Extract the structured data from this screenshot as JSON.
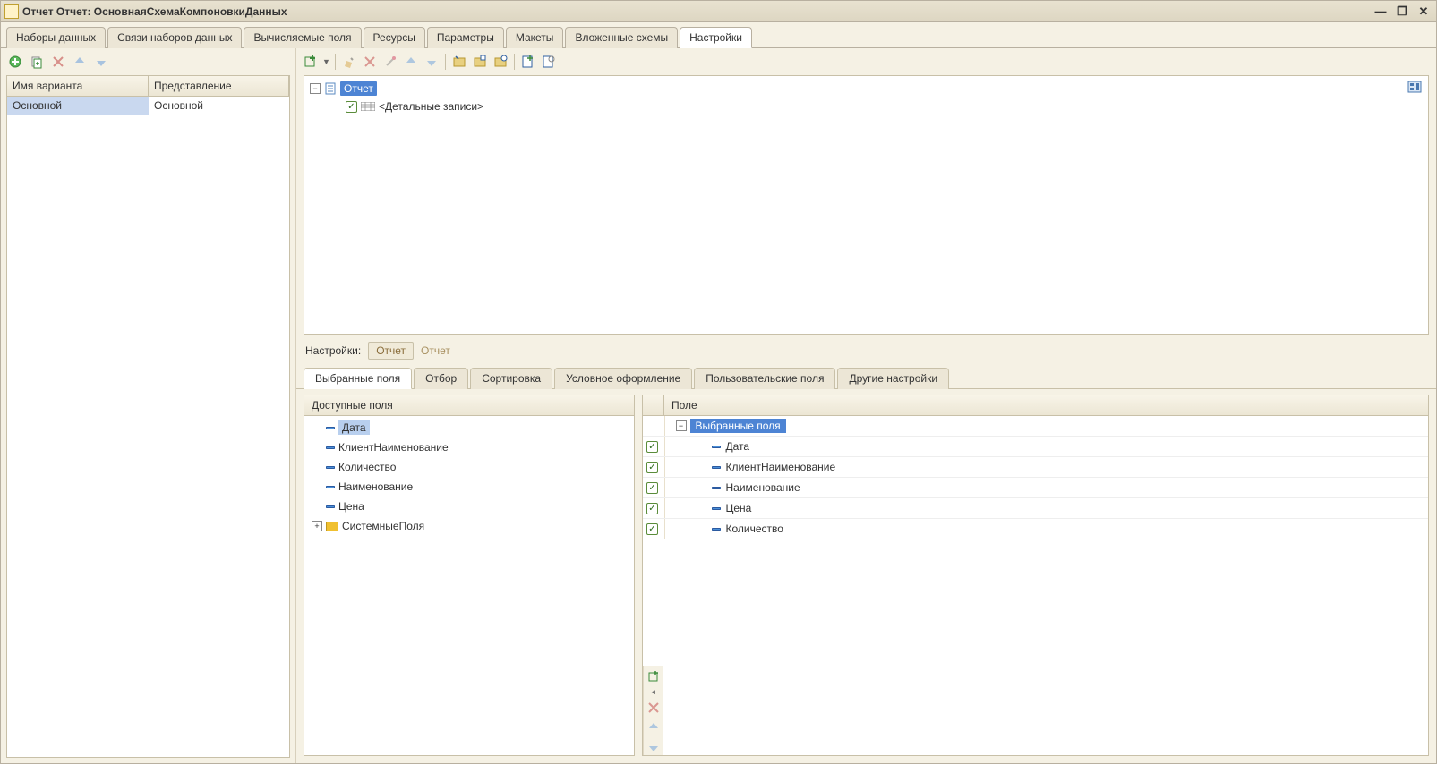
{
  "window": {
    "title": "Отчет Отчет: ОсновнаяСхемаКомпоновкиДанных"
  },
  "mainTabs": [
    {
      "label": "Наборы данных",
      "active": false
    },
    {
      "label": "Связи наборов данных",
      "active": false
    },
    {
      "label": "Вычисляемые поля",
      "active": false
    },
    {
      "label": "Ресурсы",
      "active": false
    },
    {
      "label": "Параметры",
      "active": false
    },
    {
      "label": "Макеты",
      "active": false
    },
    {
      "label": "Вложенные схемы",
      "active": false
    },
    {
      "label": "Настройки",
      "active": true
    }
  ],
  "variants": {
    "header": {
      "col1": "Имя варианта",
      "col2": "Представление"
    },
    "rows": [
      {
        "name": "Основной",
        "presentation": "Основной",
        "selected": true
      }
    ]
  },
  "reportTree": {
    "root": {
      "label": "Отчет",
      "selected": true
    },
    "child": {
      "label": "<Детальные записи>",
      "checked": true
    }
  },
  "breadcrumb": {
    "label": "Настройки:",
    "btn": "Отчет",
    "text": "Отчет"
  },
  "subTabs": [
    {
      "label": "Выбранные поля",
      "active": true
    },
    {
      "label": "Отбор",
      "active": false
    },
    {
      "label": "Сортировка",
      "active": false
    },
    {
      "label": "Условное оформление",
      "active": false
    },
    {
      "label": "Пользовательские поля",
      "active": false
    },
    {
      "label": "Другие настройки",
      "active": false
    }
  ],
  "available": {
    "header": "Доступные поля",
    "fields": [
      {
        "label": "Дата",
        "selected": true,
        "type": "field"
      },
      {
        "label": "КлиентНаименование",
        "type": "field"
      },
      {
        "label": "Количество",
        "type": "field"
      },
      {
        "label": "Наименование",
        "type": "field"
      },
      {
        "label": "Цена",
        "type": "field"
      },
      {
        "label": "СистемныеПоля",
        "type": "folder",
        "expandable": true
      }
    ]
  },
  "selected": {
    "header": "Поле",
    "group": "Выбранные поля",
    "fields": [
      {
        "label": "Дата",
        "checked": true
      },
      {
        "label": "КлиентНаименование",
        "checked": true
      },
      {
        "label": "Наименование",
        "checked": true
      },
      {
        "label": "Цена",
        "checked": true
      },
      {
        "label": "Количество",
        "checked": true
      }
    ]
  }
}
